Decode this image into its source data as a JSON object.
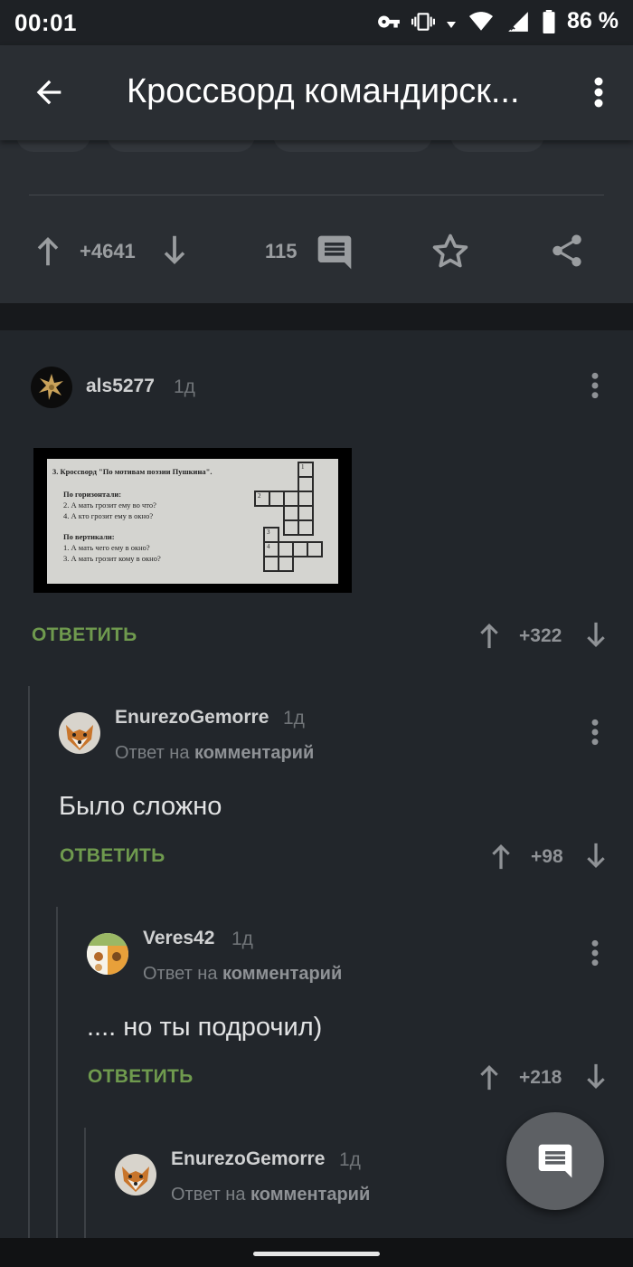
{
  "status_bar": {
    "time": "00:01",
    "battery": "86 %"
  },
  "app_bar": {
    "title": "Кроссворд командирск..."
  },
  "post": {
    "rating": "+4641",
    "comments_count": "115"
  },
  "comments": [
    {
      "author": "als5277",
      "time": "1д",
      "reply_label": "ОТВЕТИТЬ",
      "rating": "+322",
      "image": {
        "title": "3. Кроссворд \"По мотивам поэзии Пушкина\".",
        "horizontal_header": "По горизонтали:",
        "h2": "2. А мать грозит ему во что?",
        "h4": "4. А кто грозит ему в окно?",
        "vertical_header": "По вертикали:",
        "v1": "1. А мать чего ему в окно?",
        "v3": "3. А мать грозит кому в окно?",
        "num1": "1",
        "num2": "2",
        "num3": "3",
        "num4": "4"
      }
    },
    {
      "author": "EnurezoGemorre",
      "time": "1д",
      "reply_to_prefix": "Ответ на",
      "reply_to_link": "комментарий",
      "text": "Было сложно",
      "reply_label": "ОТВЕТИТЬ",
      "rating": "+98"
    },
    {
      "author": "Veres42",
      "time": "1д",
      "reply_to_prefix": "Ответ на",
      "reply_to_link": "комментарий",
      "text": ".... но ты подрочил)",
      "reply_label": "ОТВЕТИТЬ",
      "rating": "+218"
    },
    {
      "author": "EnurezoGemorre",
      "time": "1д",
      "reply_to_prefix": "Ответ на",
      "reply_to_link": "комментарий"
    }
  ],
  "icons": {
    "back": "back-arrow-icon",
    "menu": "more-vert-icon",
    "upvote": "arrow-up-icon",
    "downvote": "arrow-down-icon",
    "comments": "comment-icon",
    "save": "star-icon",
    "share": "share-icon",
    "fab": "comment-icon"
  },
  "colors": {
    "reply": "#6f9a4e",
    "background": "#22262b",
    "header": "#2a2e33"
  }
}
